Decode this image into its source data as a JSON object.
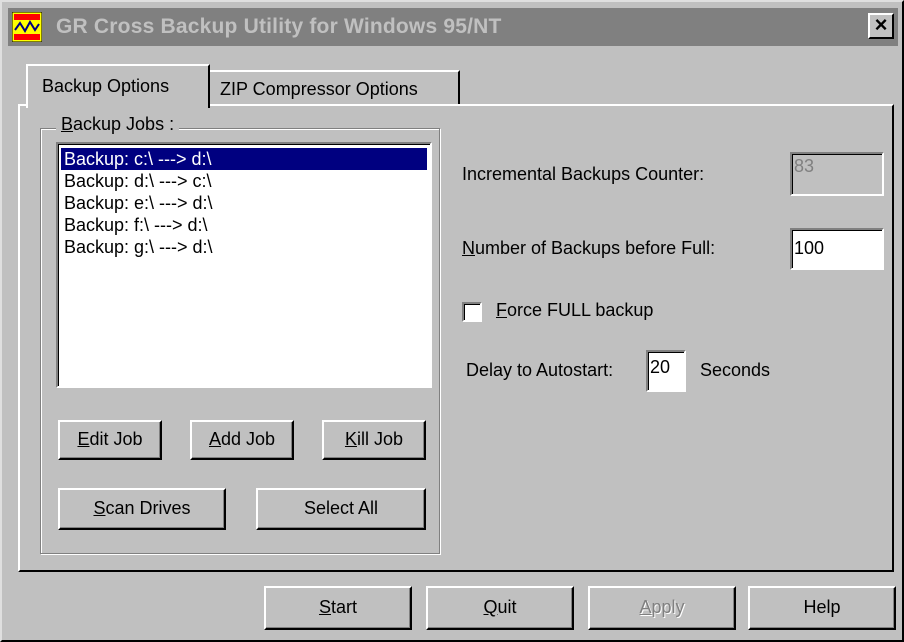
{
  "window": {
    "title": "GR Cross Backup Utility for Windows 95/NT",
    "close_symbol": "×"
  },
  "tabs": [
    {
      "label": "Backup Options",
      "active": true
    },
    {
      "label": "ZIP Compressor Options",
      "active": false
    }
  ],
  "backup_jobs": {
    "group_label_mnemonic": "B",
    "group_label_rest": "ackup Jobs :",
    "items": [
      {
        "label": "Backup: c:\\ ---> d:\\",
        "selected": true
      },
      {
        "label": "Backup: d:\\ ---> c:\\",
        "selected": false
      },
      {
        "label": "Backup: e:\\ ---> d:\\",
        "selected": false
      },
      {
        "label": "Backup: f:\\ ---> d:\\",
        "selected": false
      },
      {
        "label": "Backup: g:\\ ---> d:\\",
        "selected": false
      }
    ],
    "buttons": {
      "edit": {
        "mnemonic": "E",
        "rest": "dit Job"
      },
      "add": {
        "mnemonic": "A",
        "rest": "dd Job"
      },
      "kill": {
        "mnemonic": "K",
        "rest": "ill Job"
      },
      "scan": {
        "mnemonic": "S",
        "rest": "can Drives"
      },
      "select_all": {
        "label": "Select All"
      }
    }
  },
  "options": {
    "incremental_counter_label": "Incremental Backups Counter:",
    "incremental_counter_value": "83",
    "backups_before_full_mnemonic": "N",
    "backups_before_full_rest": "umber of Backups before Full:",
    "backups_before_full_value": "100",
    "force_full_mnemonic": "F",
    "force_full_rest": "orce FULL backup",
    "force_full_checked": false,
    "delay_label": "Delay to Autostart:",
    "delay_value": "20",
    "delay_unit": "Seconds"
  },
  "footer": {
    "start": {
      "mnemonic": "S",
      "rest": "tart"
    },
    "quit": {
      "mnemonic": "Q",
      "rest": "uit"
    },
    "apply": {
      "mnemonic": "A",
      "rest": "pply"
    },
    "help": {
      "label": "Help"
    }
  },
  "colors": {
    "face": "#c0c0c0",
    "titlebar_inactive": "#808080",
    "selection": "#000080"
  },
  "icons": {
    "app": "app-icon",
    "close": "close-icon"
  }
}
